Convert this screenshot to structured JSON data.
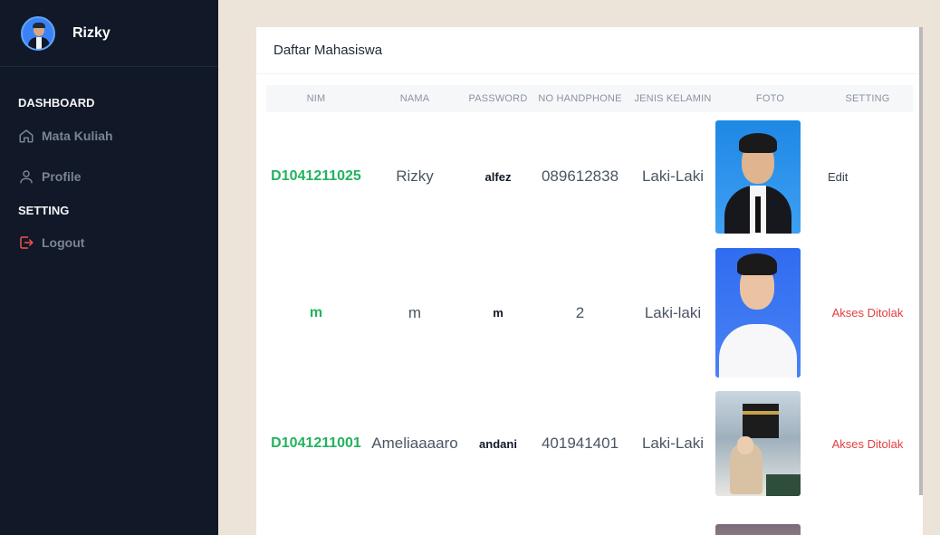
{
  "sidebar": {
    "user_name": "Rizky",
    "section_dashboard": "DASHBOARD",
    "item_mata_kuliah": "Mata Kuliah",
    "item_profile": "Profile",
    "section_setting": "SETTING",
    "item_logout": "Logout",
    "colors": {
      "background": "#111827",
      "logout_icon": "#f05252"
    }
  },
  "card": {
    "title": "Daftar Mahasiswa"
  },
  "table": {
    "headers": [
      "NIM",
      "NAMA",
      "PASSWORD",
      "NO HANDPHONE",
      "JENIS KELAMIN",
      "FOTO",
      "SETTING"
    ],
    "rows": [
      {
        "nim": "D1041211025",
        "nama": "Rizky",
        "password": "alfez",
        "no_hp": "089612838",
        "jenis_kelamin": "Laki-Laki",
        "setting": "Edit"
      },
      {
        "nim": "m",
        "nama": "m",
        "password": "m",
        "no_hp": "2",
        "jenis_kelamin": "Laki-laki",
        "setting": "Akses Ditolak"
      },
      {
        "nim": "D1041211001",
        "nama": "Ameliaaaaro",
        "password": "andani",
        "no_hp": "401941401",
        "jenis_kelamin": "Laki-Laki",
        "setting": "Akses Ditolak"
      }
    ],
    "colors": {
      "nim": "#22b35e",
      "denied": "#e53e3e"
    }
  }
}
